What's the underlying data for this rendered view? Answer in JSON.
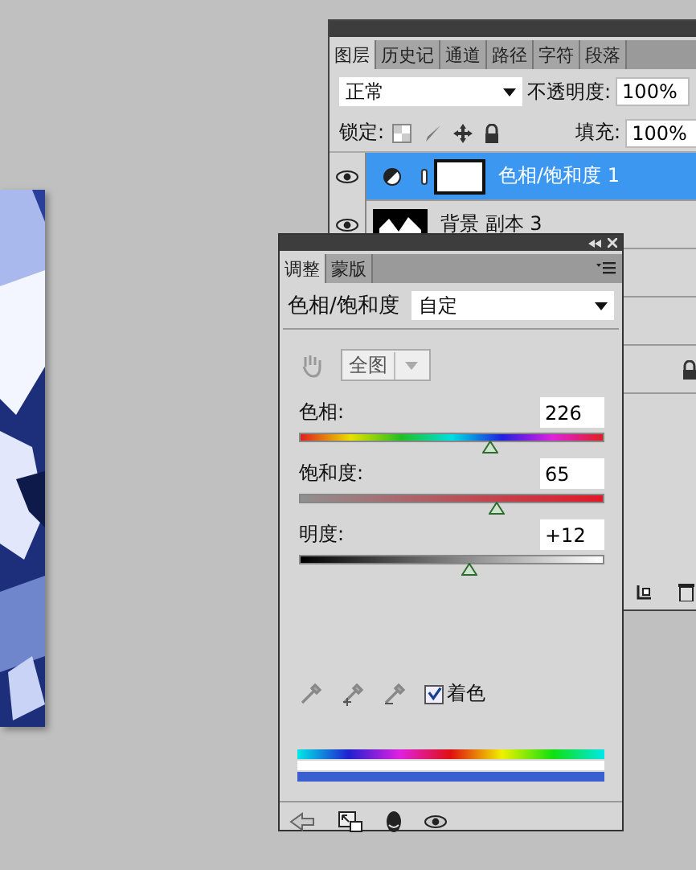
{
  "layers_panel": {
    "tabs": [
      {
        "label": "图层",
        "selected": true
      },
      {
        "label": "历史记",
        "selected": false
      },
      {
        "label": "通道",
        "selected": false
      },
      {
        "label": "路径",
        "selected": false
      },
      {
        "label": "字符",
        "selected": false
      },
      {
        "label": "段落",
        "selected": false
      }
    ],
    "blend_mode": "正常",
    "opacity_label": "不透明度:",
    "opacity": "100%",
    "lock_label": "锁定:",
    "fill_label": "填充:",
    "fill": "100%",
    "layers": [
      {
        "name": "色相/饱和度 1",
        "selected": true,
        "kind": "adjustment",
        "locked": false
      },
      {
        "name": "背景 副本 3",
        "selected": false,
        "locked": false
      },
      {
        "selected": false,
        "kind": "hidden",
        "locked": false
      },
      {
        "selected": false,
        "kind": "hidden",
        "locked": false
      },
      {
        "selected": false,
        "kind": "hidden",
        "locked": true
      }
    ]
  },
  "adjustments_panel": {
    "tabs": [
      {
        "label": "调整",
        "selected": true
      },
      {
        "label": "蒙版",
        "selected": false
      }
    ],
    "title": "色相/饱和度",
    "preset": "自定",
    "channel": "全图",
    "sliders": [
      {
        "label": "色相:",
        "value": "226",
        "level": 0.63,
        "kind": "hue"
      },
      {
        "label": "饱和度:",
        "value": "65",
        "level": 0.65,
        "kind": "saturation"
      },
      {
        "label": "明度:",
        "value": "+12",
        "level": 0.56,
        "kind": "lightness"
      }
    ],
    "colorize": {
      "label": "着色",
      "checked": true
    }
  }
}
